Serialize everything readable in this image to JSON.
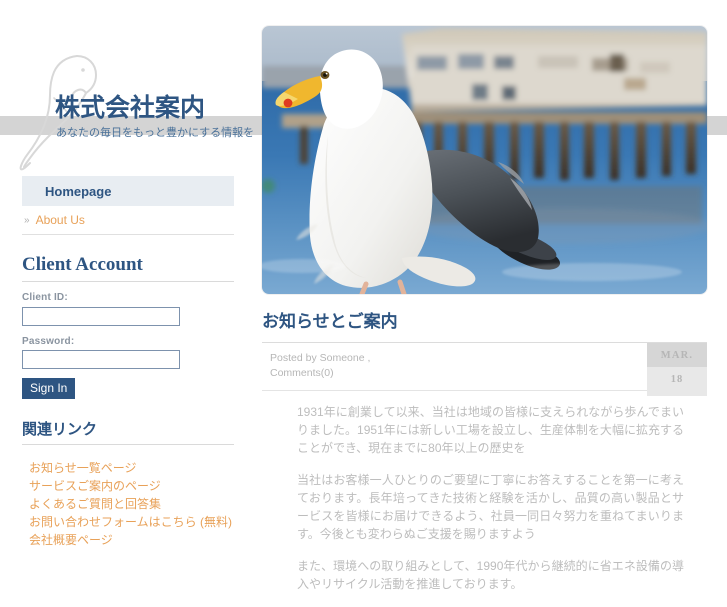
{
  "brand": {
    "title": "株式会社案内",
    "tagline": "あなたの毎日をもっと豊かにする情報を",
    "logo_icon": "parrot-outline-icon"
  },
  "nav": {
    "home_label": "Homepage",
    "sub_marker": "»",
    "sub_label": "About Us"
  },
  "account": {
    "panel_title": "Client Account",
    "client_id_label": "Client ID:",
    "client_id_value": "",
    "client_id_placeholder": "",
    "password_label": "Password:",
    "password_value": "",
    "password_placeholder": "",
    "signin_label": "Sign In"
  },
  "links_panel": {
    "title": "関連リンク",
    "items": [
      {
        "label": "お知らせ一覧ページ"
      },
      {
        "label": "サービスご案内のページ"
      },
      {
        "label": "よくあるご質問と回答集"
      },
      {
        "label": "お問い合わせフォームはこちら (無料)"
      },
      {
        "label": "会社概要ページ"
      }
    ]
  },
  "hero": {
    "alt": "seagull-on-pier-photo",
    "caption": ""
  },
  "post": {
    "title": "お知らせとご案内",
    "posted_by": "Posted by Someone ,",
    "comments": "Comments(0)",
    "date_month": "MAR.",
    "date_day": "18",
    "paragraphs": [
      "1931年に創業して以来、当社は地域の皆様に支えられながら歩んでまいりました。1951年には新しい工場を設立し、生産体制を大幅に拡充することができ、現在までに80年以上の歴史を",
      "当社はお客様一人ひとりのご要望に丁寧にお答えすることを第一に考えております。長年培ってきた技術と経験を活かし、品質の高い製品とサービスを皆様にお届けできるよう、社員一同日々努力を重ねてまいります。今後とも変わらぬご支援を賜りますよう",
      "また、環境への取り組みとして、1990年代から継続的に省エネ設備の導入やリサイクル活動を推進しております。"
    ]
  },
  "colors": {
    "brand_navy": "#2e5582",
    "accent_orange": "#e8a158",
    "band_gray": "#d4d4d4",
    "nav_bg": "#e8edf2",
    "body_text": "#bdbdbd"
  }
}
